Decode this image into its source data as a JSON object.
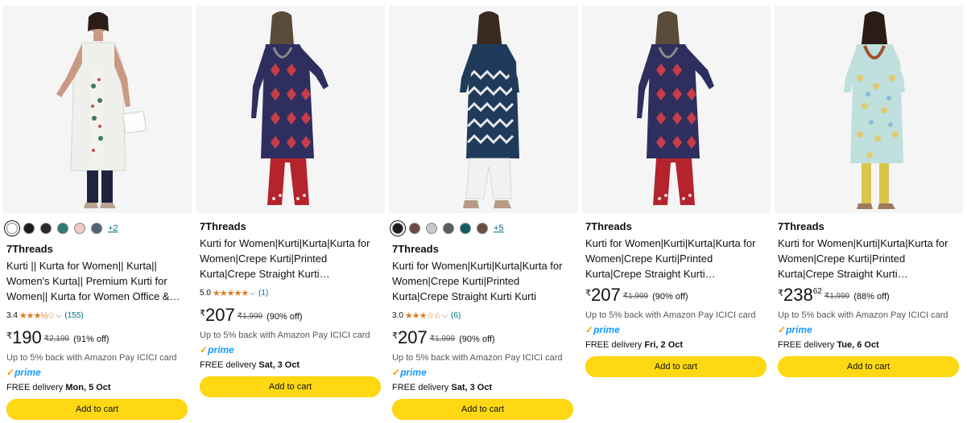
{
  "products": [
    {
      "swatches": [
        "#ffffff",
        "#1c1c1c",
        "#2b2930",
        "#2f7a6e",
        "#f3c9c6",
        "#4f6275"
      ],
      "swatches_more": "+2",
      "brand": "7Threads",
      "title": "Kurti || Kurta for Women|| Kurta|| Women's Kurta|| Premium Kurti for Women|| Kurta for Women Office &…",
      "rating": "3.4",
      "stars": "★★★½☆",
      "review_count": "(155)",
      "currency": "₹",
      "price": "190",
      "price_fraction": "",
      "mrp": "₹2,199",
      "discount": "(91% off)",
      "cashback": "Up to 5% back with Amazon Pay ICICI card",
      "prime": "prime",
      "delivery_prefix": "FREE delivery ",
      "delivery_date": "Mon, 5 Oct",
      "cart_label": "Add to cart"
    },
    {
      "brand": "7Threads",
      "title": "Kurti for Women|Kurti|Kurta|Kurta for Women|Crepe Kurti|Printed Kurta|Crepe Straight Kurti…",
      "rating": "5.0",
      "stars": "★★★★★",
      "review_count": "(1)",
      "currency": "₹",
      "price": "207",
      "price_fraction": "",
      "mrp": "₹1,999",
      "discount": "(90% off)",
      "cashback": "Up to 5% back with Amazon Pay ICICI card",
      "prime": "prime",
      "delivery_prefix": "FREE delivery ",
      "delivery_date": "Sat, 3 Oct",
      "cart_label": "Add to cart"
    },
    {
      "swatches": [
        "#1c1c1c",
        "#6d4a45",
        "#c9c9c9",
        "#5a5a5a",
        "#105a66",
        "#6a4c3c"
      ],
      "swatches_more": "+5",
      "brand": "7Threads",
      "title": "Kurti for Women|Kurti|Kurta|Kurta for Women|Crepe Kurti|Printed Kurta|Crepe Straight Kurti Kurti",
      "rating": "3.0",
      "stars": "★★★☆☆",
      "review_count": "(6)",
      "currency": "₹",
      "price": "207",
      "price_fraction": "",
      "mrp": "₹1,999",
      "discount": "(90% off)",
      "cashback": "Up to 5% back with Amazon Pay ICICI card",
      "prime": "prime",
      "delivery_prefix": "FREE delivery ",
      "delivery_date": "Sat, 3 Oct",
      "cart_label": "Add to cart"
    },
    {
      "brand": "7Threads",
      "title": "Kurti for Women|Kurti|Kurta|Kurta for Women|Crepe Kurti|Printed Kurta|Crepe Straight Kurti…",
      "currency": "₹",
      "price": "207",
      "price_fraction": "",
      "mrp": "₹1,999",
      "discount": "(90% off)",
      "cashback": "Up to 5% back with Amazon Pay ICICI card",
      "prime": "prime",
      "delivery_prefix": "FREE delivery ",
      "delivery_date": "Fri, 2 Oct",
      "cart_label": "Add to cart"
    },
    {
      "brand": "7Threads",
      "title": "Kurti for Women|Kurti|Kurta|Kurta for Women|Crepe Kurti|Printed Kurta|Crepe Straight Kurti…",
      "currency": "₹",
      "price": "238",
      "price_fraction": "62",
      "mrp": "₹1,999",
      "discount": "(88% off)",
      "cashback": "Up to 5% back with Amazon Pay ICICI card",
      "prime": "prime",
      "delivery_prefix": "FREE delivery ",
      "delivery_date": "Tue, 6 Oct",
      "cart_label": "Add to cart"
    }
  ],
  "colors": {
    "accent_button": "#ffd814",
    "prime_blue": "#1399ff",
    "link": "#007185",
    "star": "#de7921"
  }
}
